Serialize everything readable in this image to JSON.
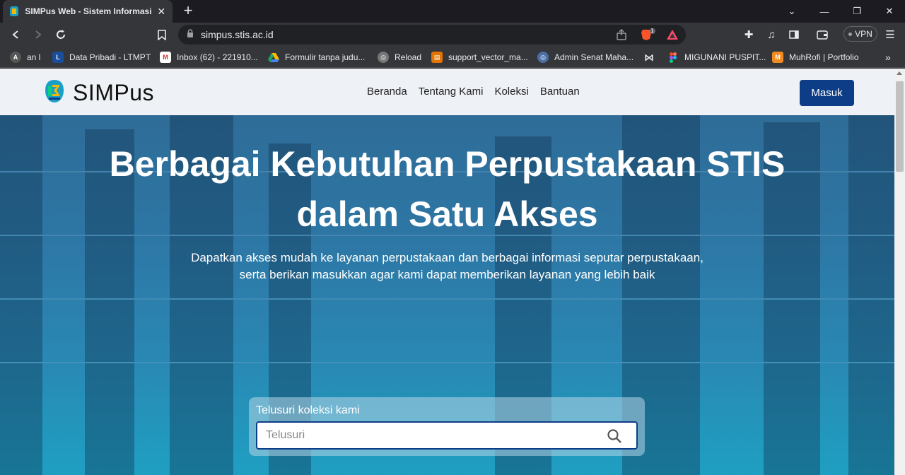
{
  "browser": {
    "tab_title": "SIMPus Web - Sistem Informasi P...",
    "url": "simpus.stis.ac.id",
    "vpn_label": "VPN",
    "brave_badge": "1",
    "bookmarks": [
      {
        "label": "an l",
        "icon": "site-icon",
        "color": "#555"
      },
      {
        "label": "Data Pribadi - LTMPT",
        "icon": "ltmpt-icon",
        "color": "#1a4e9a"
      },
      {
        "label": "Inbox (62) - 221910...",
        "icon": "gmail-icon",
        "color": "#d93025"
      },
      {
        "label": "Formulir tanpa judu...",
        "icon": "drive-icon",
        "color": "#1fa463"
      },
      {
        "label": "Reload",
        "icon": "globe-icon",
        "color": "#777"
      },
      {
        "label": "support_vector_ma...",
        "icon": "notebook-icon",
        "color": "#e37400"
      },
      {
        "label": "Admin Senat Maha...",
        "icon": "globe-icon",
        "color": "#4a6fa5"
      },
      {
        "label": "",
        "icon": "bowtie-icon",
        "color": "#222"
      },
      {
        "label": "MIGUNANI PUSPIT...",
        "icon": "figma-icon",
        "color": "#a259ff"
      },
      {
        "label": "MuhRofi | Portfolio",
        "icon": "portfolio-icon",
        "color": "#f28b20"
      }
    ]
  },
  "nav": {
    "brand": "SIMPus",
    "links": [
      "Beranda",
      "Tentang Kami",
      "Koleksi",
      "Bantuan"
    ],
    "login_label": "Masuk"
  },
  "hero": {
    "title_line1": "Berbagai Kebutuhan Perpustakaan STIS",
    "title_line2": "dalam Satu Akses",
    "subtitle_line1": "Dapatkan akses mudah ke layanan perpustakaan dan berbagai informasi seputar perpustakaan,",
    "subtitle_line2": "serta berikan masukkan agar kami dapat memberikan layanan yang lebih baik"
  },
  "search": {
    "label": "Telusuri koleksi kami",
    "placeholder": "Telusuri"
  },
  "colors": {
    "primary": "#0d3d87",
    "navbar_bg": "#eef1f5",
    "hero_top": "#2f6c98",
    "hero_bottom": "#1f9fc2"
  }
}
